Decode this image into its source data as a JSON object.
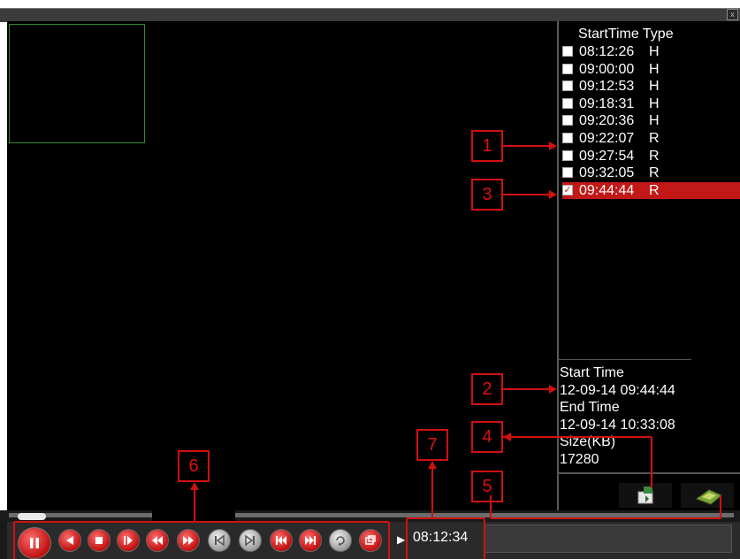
{
  "window": {
    "close_label": "x"
  },
  "record_list": {
    "header_starttime": "StartTime",
    "header_type": "Type",
    "records": [
      {
        "time": "08:12:26",
        "type": "H",
        "checked": false
      },
      {
        "time": "09:00:00",
        "type": "H",
        "checked": false
      },
      {
        "time": "09:12:53",
        "type": "H",
        "checked": false
      },
      {
        "time": "09:18:31",
        "type": "H",
        "checked": false
      },
      {
        "time": "09:20:36",
        "type": "H",
        "checked": false
      },
      {
        "time": "09:22:07",
        "type": "R",
        "checked": false
      },
      {
        "time": "09:27:54",
        "type": "R",
        "checked": false
      },
      {
        "time": "09:32:05",
        "type": "R",
        "checked": false
      },
      {
        "time": "09:44:44",
        "type": "R",
        "checked": true
      }
    ]
  },
  "file_info": {
    "start_time_label": "Start Time",
    "start_time_value": "12-09-14 09:44:44",
    "end_time_label": "End Time",
    "end_time_value": "12-09-14 10:33:08",
    "size_label": "Size(KB)",
    "size_value": "17280"
  },
  "playback": {
    "current_time": "08:12:34",
    "progress_fraction": 0.02
  },
  "controls": [
    "pause-icon",
    "reverse-play-icon",
    "stop-icon",
    "frame-step-icon",
    "slow-play-icon",
    "fast-play-icon",
    "previous-frame-icon",
    "next-frame-icon",
    "previous-file-icon",
    "next-file-icon",
    "loop-icon",
    "fullscreen-icon"
  ],
  "side_buttons": [
    "backup-icon",
    "search-icon"
  ],
  "annotations": [
    "1",
    "2",
    "3",
    "4",
    "5",
    "6",
    "7"
  ],
  "colors": {
    "accent_red": "#c21818",
    "annotation_red": "#d01010",
    "pip_border": "#2f8a2f"
  }
}
